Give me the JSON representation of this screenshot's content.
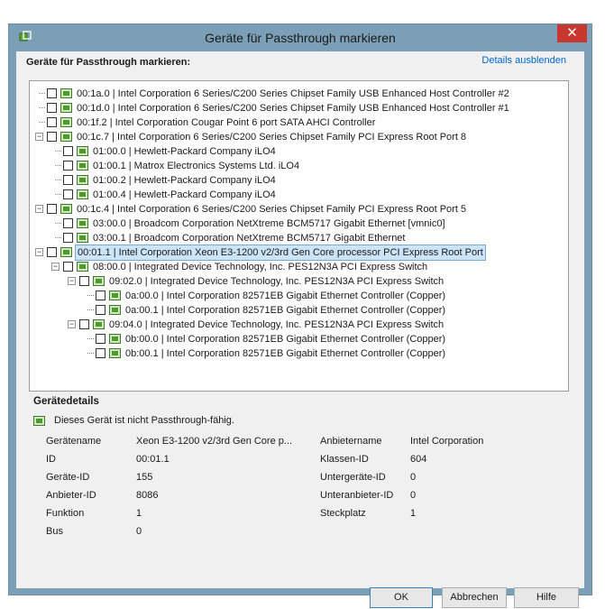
{
  "window": {
    "title": "Geräte für Passthrough markieren",
    "close_glyph": "✕"
  },
  "header": {
    "label": "Geräte für Passthrough markieren:",
    "details_link": "Details ausblenden"
  },
  "tree": [
    {
      "level": 0,
      "expander": "",
      "text": "00:1a.0 | Intel Corporation 6 Series/C200 Series Chipset Family USB Enhanced Host Controller #2"
    },
    {
      "level": 0,
      "expander": "",
      "text": "00:1d.0 | Intel Corporation 6 Series/C200 Series Chipset Family USB Enhanced Host Controller #1"
    },
    {
      "level": 0,
      "expander": "",
      "text": "00:1f.2 | Intel Corporation Cougar Point 6 port SATA AHCI Controller"
    },
    {
      "level": 0,
      "expander": "−",
      "text": "00:1c.7 | Intel Corporation 6 Series/C200 Series Chipset Family PCI Express Root Port 8"
    },
    {
      "level": 1,
      "expander": "",
      "text": "01:00.0 | Hewlett-Packard Company iLO4"
    },
    {
      "level": 1,
      "expander": "",
      "text": "01:00.1 | Matrox Electronics Systems Ltd. iLO4"
    },
    {
      "level": 1,
      "expander": "",
      "text": "01:00.2 | Hewlett-Packard Company iLO4"
    },
    {
      "level": 1,
      "expander": "",
      "text": "01:00.4 | Hewlett-Packard Company iLO4"
    },
    {
      "level": 0,
      "expander": "−",
      "text": "00:1c.4 | Intel Corporation 6 Series/C200 Series Chipset Family PCI Express Root Port 5"
    },
    {
      "level": 1,
      "expander": "",
      "text": "03:00.0 | Broadcom Corporation NetXtreme BCM5717 Gigabit Ethernet [vmnic0]"
    },
    {
      "level": 1,
      "expander": "",
      "text": "03:00.1 | Broadcom Corporation NetXtreme BCM5717 Gigabit Ethernet"
    },
    {
      "level": 0,
      "expander": "−",
      "text": "00:01.1 | Intel Corporation Xeon E3-1200 v2/3rd Gen Core processor PCI Express Root Port",
      "selected": true
    },
    {
      "level": 1,
      "expander": "−",
      "text": "08:00.0 | Integrated Device Technology, Inc. PES12N3A PCI Express Switch"
    },
    {
      "level": 2,
      "expander": "−",
      "text": "09:02.0 | Integrated Device Technology, Inc. PES12N3A PCI Express Switch"
    },
    {
      "level": 3,
      "expander": "",
      "text": "0a:00.0 | Intel Corporation 82571EB Gigabit Ethernet Controller (Copper)"
    },
    {
      "level": 3,
      "expander": "",
      "text": "0a:00.1 | Intel Corporation 82571EB Gigabit Ethernet Controller (Copper)"
    },
    {
      "level": 2,
      "expander": "−",
      "text": "09:04.0 | Integrated Device Technology, Inc. PES12N3A PCI Express Switch"
    },
    {
      "level": 3,
      "expander": "",
      "text": "0b:00.0 | Intel Corporation 82571EB Gigabit Ethernet Controller (Copper)"
    },
    {
      "level": 3,
      "expander": "",
      "text": "0b:00.1 | Intel Corporation 82571EB Gigabit Ethernet Controller (Copper)"
    }
  ],
  "details": {
    "section_title": "Gerätedetails",
    "info": "Dieses Gerät ist nicht Passthrough-fähig.",
    "left": [
      {
        "label": "Gerätename",
        "value": "Xeon E3-1200 v2/3rd Gen Core p..."
      },
      {
        "label": "ID",
        "value": "00:01.1"
      },
      {
        "label": "Geräte-ID",
        "value": "155"
      },
      {
        "label": "Anbieter-ID",
        "value": "8086"
      },
      {
        "label": "Funktion",
        "value": "1"
      },
      {
        "label": "Bus",
        "value": "0"
      }
    ],
    "right": [
      {
        "label": "Anbietername",
        "value": "Intel Corporation"
      },
      {
        "label": "Klassen-ID",
        "value": "604"
      },
      {
        "label": "Untergeräte-ID",
        "value": "0"
      },
      {
        "label": "Unteranbieter-ID",
        "value": "0"
      },
      {
        "label": "Steckplatz",
        "value": "1"
      }
    ]
  },
  "buttons": {
    "ok": "OK",
    "cancel": "Abbrechen",
    "help": "Hilfe"
  },
  "colors": {
    "accent": "#3c7fb1",
    "close": "#c7372f",
    "link": "#0066cc",
    "selection": "#cce4f7"
  }
}
